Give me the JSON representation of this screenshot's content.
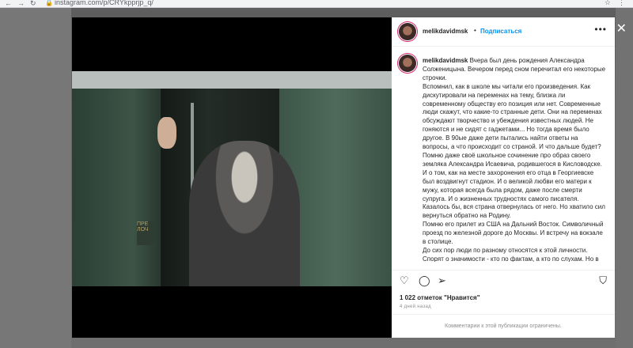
{
  "browser": {
    "url": "instagram.com/p/CRYkpprjp_q/",
    "icons": {
      "back": "back-arrow-icon",
      "forward": "forward-arrow-icon",
      "reload": "reload-icon",
      "lock": "lock-icon",
      "star": "bookmark-star-icon",
      "extensions": "extensions-icon"
    }
  },
  "modal": {
    "close_icon": "close-icon"
  },
  "post": {
    "username": "melikdavidmsk",
    "separator": "•",
    "follow_label": "Подписаться",
    "more_icon": "•••",
    "caption_username": "melikdavidmsk",
    "caption": " Вчера был день рождения Александра Солженицына. Вечером перед сном перечитал его некоторые строчки.\nВспомнил, как в школе мы читали его произведения. Как дискутировали на переменах на тему, близка ли современному обществу его позиция или нет. Современные люди скажут, что какие-то странные дети. Они на переменах обсуждают творчество и убеждения известных людей. Не гоняются и не сидят с гаджетами... Но тогда время было другое. В 90ые даже дети пытались найти ответы на вопросы, а что происходит со страной. И что дальше будет?\nПомню даже своё школьное сочинение про образ своего земляка Александра Исаевича, родившегося в Кисловодске. И о том, как на месте захоронения его отца в Георгиевске был воздвигнут стадион. И о великой любви его матери к мужу, которая всегда была рядом, даже после смерти супруга. И о жизненных трудностях самого писателя. Казалось бы, вся страна отвернулась от него. Но хватило сил вернуться обратно на Родину.\nПомню его прилет из США на Дальний Восток. Символичный проезд по железной дороге до Москвы. И встречу на вокзале в столице.\nДо сих пор люди по разному относятся к этой личности. Спорят о значимости - кто по фактам, а кто по слухам. Но в том, что это ЛИЧНОСТЬ, сомнений никаких ни у кого нет. Многое в его трудах и философии будет ещё долго очень актуально.",
    "actions": {
      "like": "♡",
      "comment": "◯",
      "share": "➢",
      "save": "⛉"
    },
    "likes": "1 022 отметок \"Нравится\"",
    "date": "4 дней назад",
    "comments_limited": "Комментарии к этой публикации ограничены."
  },
  "photo": {
    "plate_text": "ПРЕ ЛОЧ"
  }
}
